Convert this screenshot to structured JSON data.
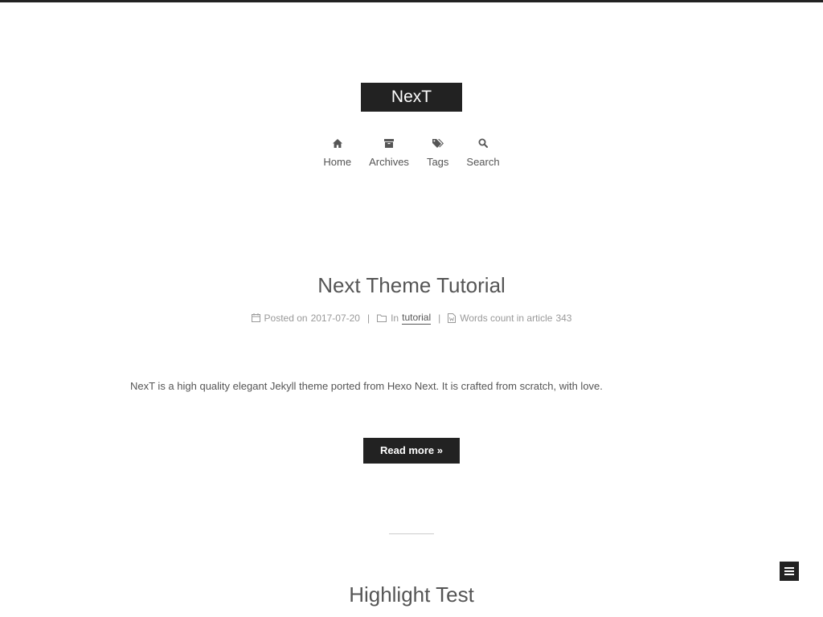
{
  "site": {
    "brand": "NexT"
  },
  "menu": [
    {
      "label": "Home",
      "icon": "home-icon"
    },
    {
      "label": "Archives",
      "icon": "archive-icon"
    },
    {
      "label": "Tags",
      "icon": "tags-icon"
    },
    {
      "label": "Search",
      "icon": "search-icon"
    }
  ],
  "posts": [
    {
      "title": "Next Theme Tutorial",
      "posted_on_label": "Posted on",
      "date": "2017-07-20",
      "in_label": "In",
      "category": "tutorial",
      "words_label": "Words count in article",
      "words": "343",
      "excerpt": "NexT is a high quality elegant Jekyll theme ported from Hexo Next. It is crafted from scratch, with love.",
      "read_more": "Read more »"
    },
    {
      "title": "Highlight Test"
    }
  ],
  "colors": {
    "dark": "#222222",
    "text": "#555555",
    "meta": "#999999"
  }
}
